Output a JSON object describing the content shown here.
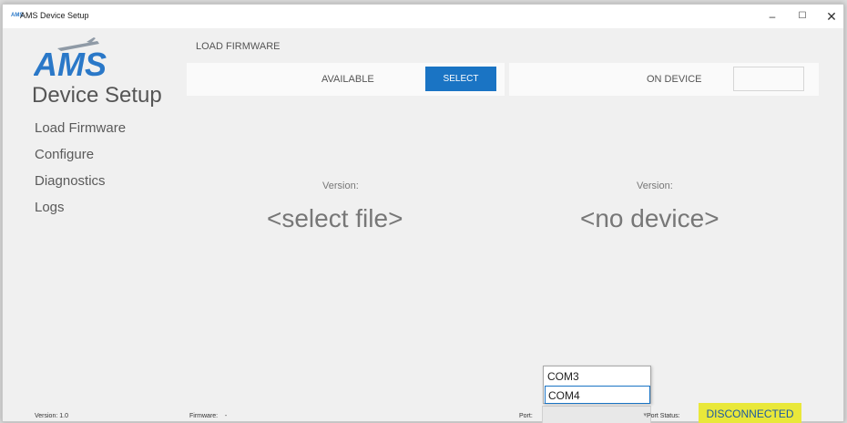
{
  "window": {
    "title": "AMS Device Setup",
    "app_icon_text": "AMS",
    "controls": {
      "minimize": "–",
      "maximize": "☐",
      "close": "✕"
    }
  },
  "logo": {
    "brand": "AMS",
    "subtitle": "Device Setup"
  },
  "sidebar": {
    "items": [
      {
        "label": "Load Firmware"
      },
      {
        "label": "Configure"
      },
      {
        "label": "Diagnostics"
      },
      {
        "label": "Logs"
      }
    ]
  },
  "main": {
    "section_title": "LOAD FIRMWARE",
    "available_label": "AVAILABLE",
    "select_button": "SELECT",
    "on_device_label": "ON DEVICE",
    "left_version_label": "Version:",
    "left_value": "<select file>",
    "right_version_label": "Version:",
    "right_value": "<no device>"
  },
  "status_bar": {
    "version": "Version: 1.0",
    "firmware_label": "Firmware:",
    "firmware_value": "-",
    "port_label": "Port:",
    "port_status_label": "Port Status:",
    "port_status_value": "DISCONNECTED"
  },
  "port_dropdown": {
    "options": [
      "COM3",
      "COM4"
    ],
    "highlighted": "COM4"
  },
  "colors": {
    "accent": "#1a74c4",
    "status_bg": "#e9e83a",
    "status_text": "#1e5aa0",
    "background": "#f0f0f0"
  }
}
